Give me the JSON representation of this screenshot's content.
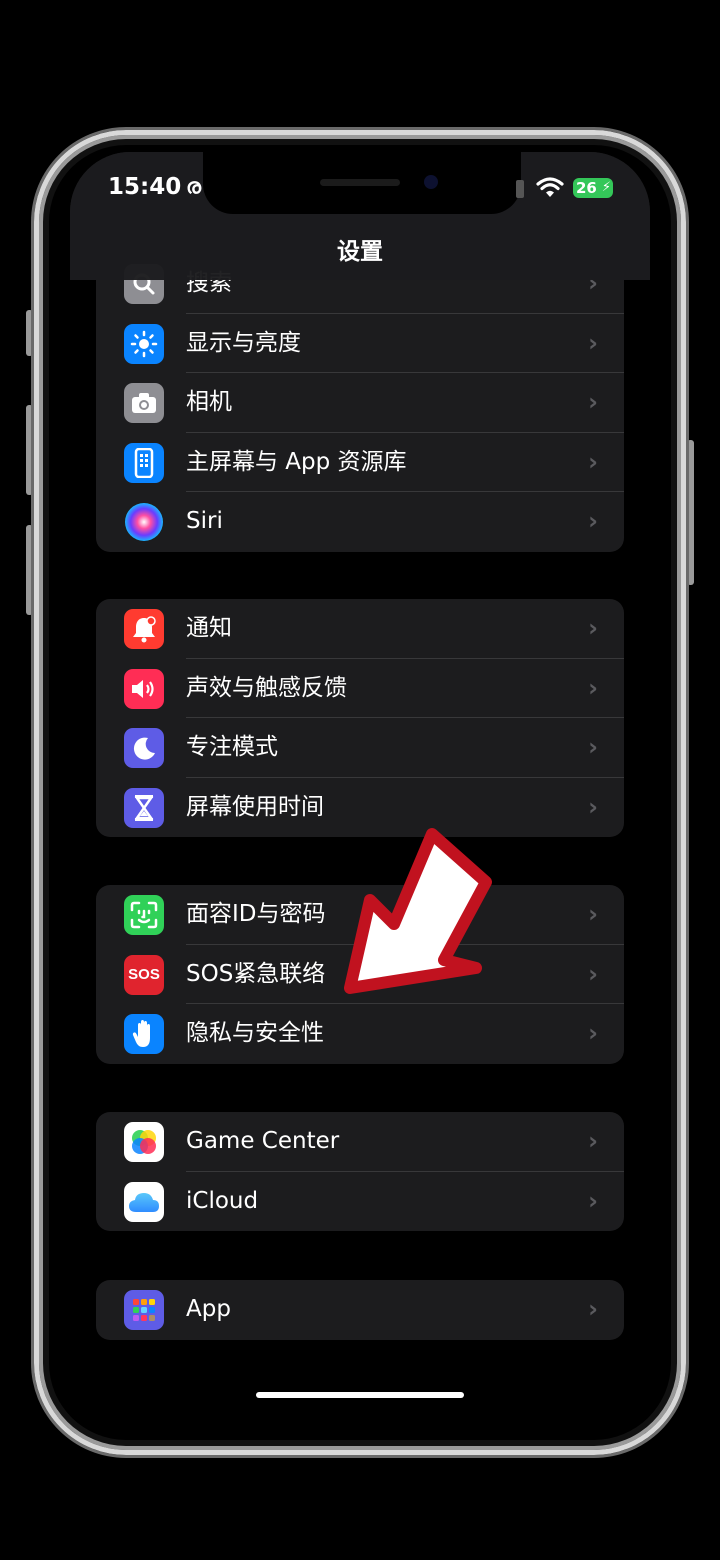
{
  "status_bar": {
    "time": "15:40",
    "time_icon": "ര",
    "battery": "26",
    "battery_color": "#34c759"
  },
  "nav": {
    "title": "设置"
  },
  "groups": [
    {
      "items": [
        {
          "label": "搜索",
          "icon": "search-icon",
          "color": "#8e8e93"
        },
        {
          "label": "显示与亮度",
          "icon": "brightness-icon",
          "color": "#0a84ff"
        },
        {
          "label": "相机",
          "icon": "camera-icon",
          "color": "#8e8e93"
        },
        {
          "label": "主屏幕与 App 资源库",
          "icon": "home-screen-icon",
          "color": "#0a84ff"
        },
        {
          "label": "Siri",
          "icon": "siri-icon",
          "color": "#1c1c1e"
        }
      ]
    },
    {
      "items": [
        {
          "label": "通知",
          "icon": "notification-bell-icon",
          "color": "#ff3b30"
        },
        {
          "label": "声效与触感反馈",
          "icon": "speaker-icon",
          "color": "#ff2d55"
        },
        {
          "label": "专注模式",
          "icon": "moon-icon",
          "color": "#5e5ce6"
        },
        {
          "label": "屏幕使用时间",
          "icon": "hourglass-icon",
          "color": "#5e5ce6"
        }
      ]
    },
    {
      "items": [
        {
          "label": "面容ID与密码",
          "icon": "face-id-icon",
          "color": "#30d158"
        },
        {
          "label": "SOS紧急联络",
          "icon": "sos-icon",
          "color": "#e0242e",
          "icon_text": "SOS"
        },
        {
          "label": "隐私与安全性",
          "icon": "hand-icon",
          "color": "#0a84ff"
        }
      ]
    },
    {
      "items": [
        {
          "label": "Game Center",
          "icon": "game-center-icon",
          "color": "#ffffff"
        },
        {
          "label": "iCloud",
          "icon": "icloud-icon",
          "color": "#ffffff"
        }
      ]
    },
    {
      "items": [
        {
          "label": "App",
          "icon": "app-grid-icon",
          "color": "#5e5ce6"
        }
      ]
    }
  ],
  "chevron": "›",
  "annotation": {
    "arrow_color": "#c1121f",
    "icon": "red-pointer-arrow-icon"
  }
}
